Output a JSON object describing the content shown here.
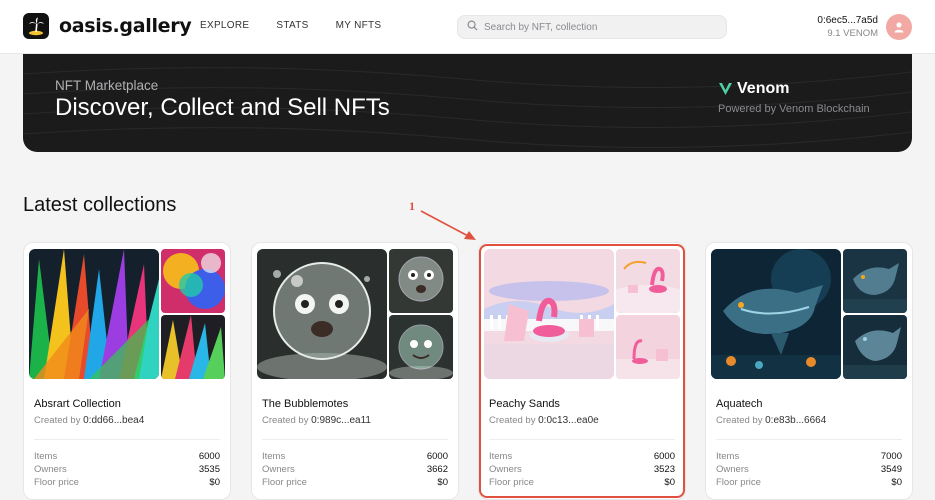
{
  "header": {
    "logo_text": "oasis.gallery",
    "nav": [
      {
        "label": "EXPLORE"
      },
      {
        "label": "STATS"
      },
      {
        "label": "MY NFTS"
      }
    ],
    "search": {
      "placeholder": "Search by NFT, collection",
      "value": ""
    },
    "wallet": {
      "address": "0:6ec5...7a5d",
      "balance": "9.1 VENOM"
    }
  },
  "banner": {
    "eyebrow": "NFT Marketplace",
    "title": "Discover, Collect and Sell NFTs",
    "brand": "Venom",
    "brand_sub": "Powered by Venom Blockchain"
  },
  "section": {
    "title": "Latest collections"
  },
  "stat_labels": {
    "items": "Items",
    "owners": "Owners",
    "floor": "Floor price",
    "created_by": "Created by"
  },
  "collections": [
    {
      "name": "Absrart Collection",
      "creator": "0:dd66...bea4",
      "items": "6000",
      "owners": "3535",
      "floor": "$0"
    },
    {
      "name": "The Bubblemotes",
      "creator": "0:989c...ea11",
      "items": "6000",
      "owners": "3662",
      "floor": "$0"
    },
    {
      "name": "Peachy Sands",
      "creator": "0:0c13...ea0e",
      "items": "6000",
      "owners": "3523",
      "floor": "$0"
    },
    {
      "name": "Aquatech",
      "creator": "0:e83b...6664",
      "items": "7000",
      "owners": "3549",
      "floor": "$0"
    }
  ],
  "annotation": {
    "label": "1",
    "color": "#e0523f"
  }
}
